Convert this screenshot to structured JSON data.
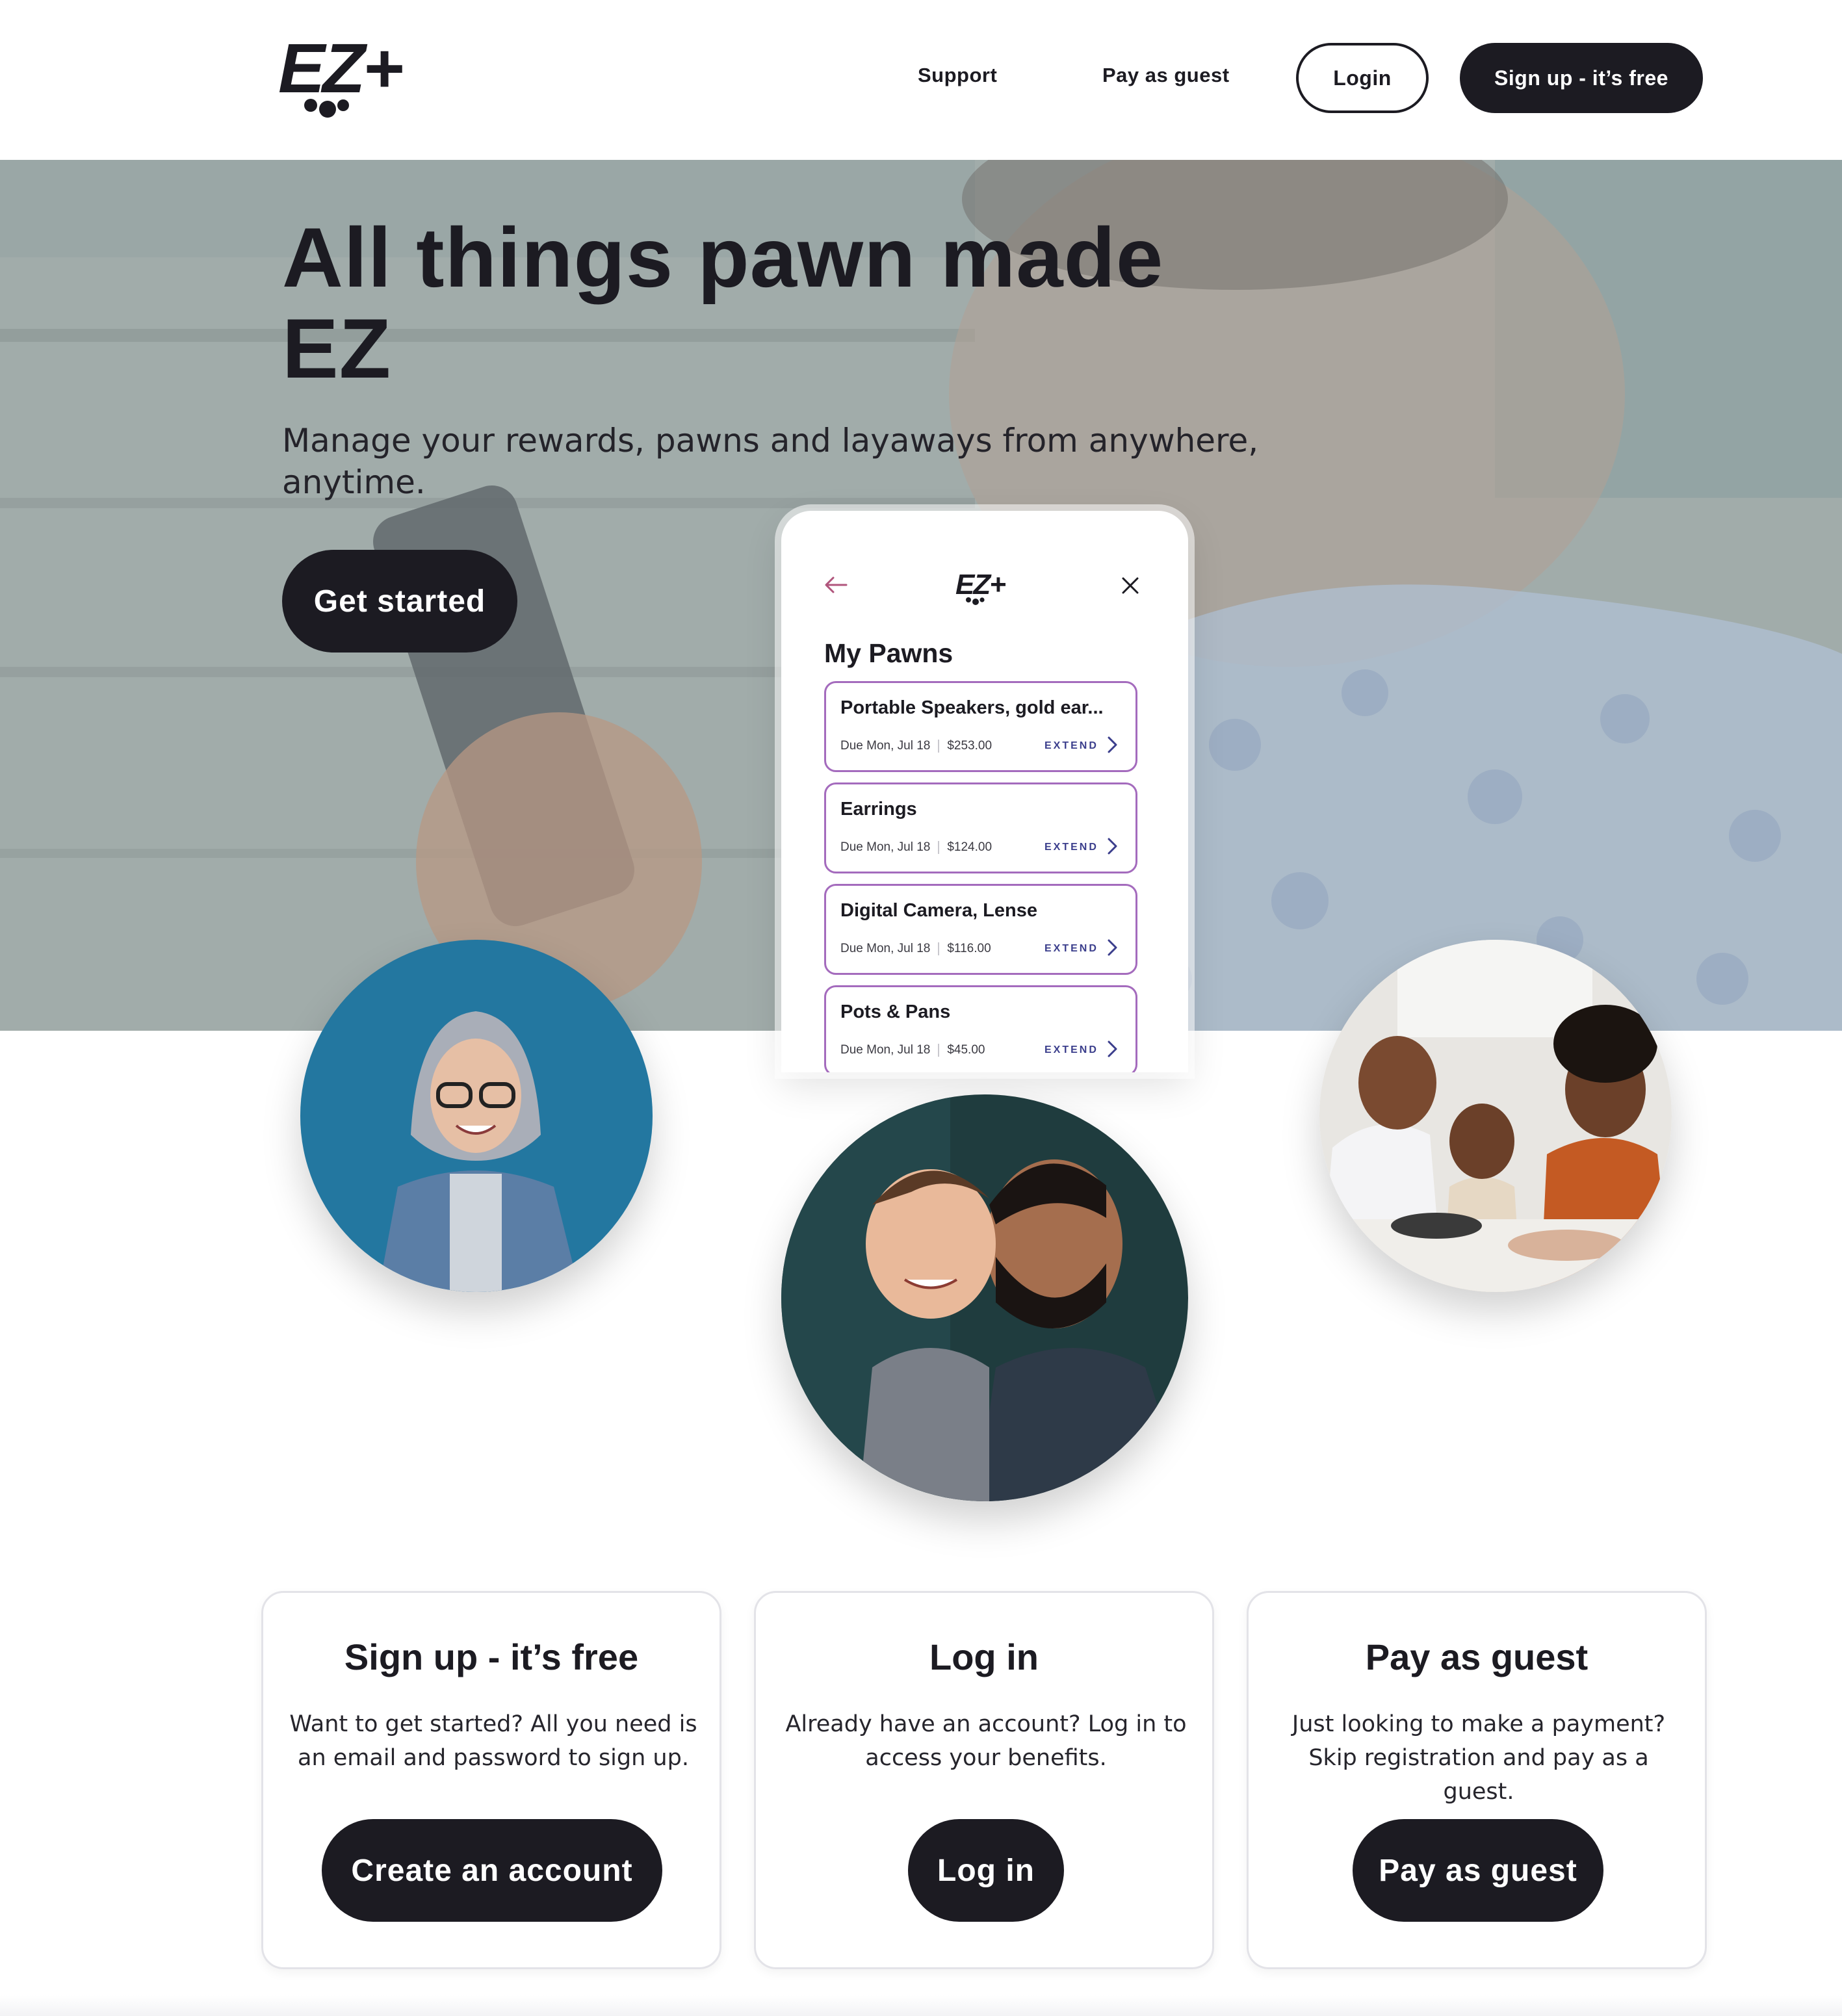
{
  "nav": {
    "support": "Support",
    "pay_as_guest": "Pay as guest",
    "login": "Login",
    "signup": "Sign up - it’s free"
  },
  "brand": {
    "logo_text": "EZ+",
    "logo_icon": "ez-plus-logo",
    "accent": "#1c1b22",
    "pawn_border": "#a46bbd",
    "extend_color": "#3b3e8c"
  },
  "hero": {
    "title": "All things pawn made EZ",
    "subtitle": "Manage your rewards, pawns and layaways from anywhere, anytime.",
    "cta": "Get started"
  },
  "phone": {
    "logo_text": "EZ+",
    "heading": "My Pawns",
    "back_icon": "arrow-left-icon",
    "close_icon": "close-icon",
    "pawns": [
      {
        "name": "Portable Speakers, gold ear...",
        "due": "Due Mon, Jul 18",
        "amount": "$253.00",
        "action": "EXTEND"
      },
      {
        "name": "Earrings",
        "due": "Due Mon, Jul 18",
        "amount": "$124.00",
        "action": "EXTEND"
      },
      {
        "name": "Digital Camera, Lense",
        "due": "Due Mon, Jul 18",
        "amount": "$116.00",
        "action": "EXTEND"
      },
      {
        "name": "Pots & Pans",
        "due": "Due Mon, Jul 18",
        "amount": "$45.00",
        "action": "EXTEND"
      }
    ]
  },
  "cards": [
    {
      "title": "Sign up - it’s free",
      "text": "Want to get started? All you need is an email and password to sign up.",
      "button": "Create an account"
    },
    {
      "title": "Log in",
      "text": "Already have an account? Log in to access your benefits.",
      "button": "Log in"
    },
    {
      "title": "Pay as guest",
      "text": "Just looking to make a payment? Skip registration and pay as a guest.",
      "button": "Pay as guest"
    }
  ]
}
